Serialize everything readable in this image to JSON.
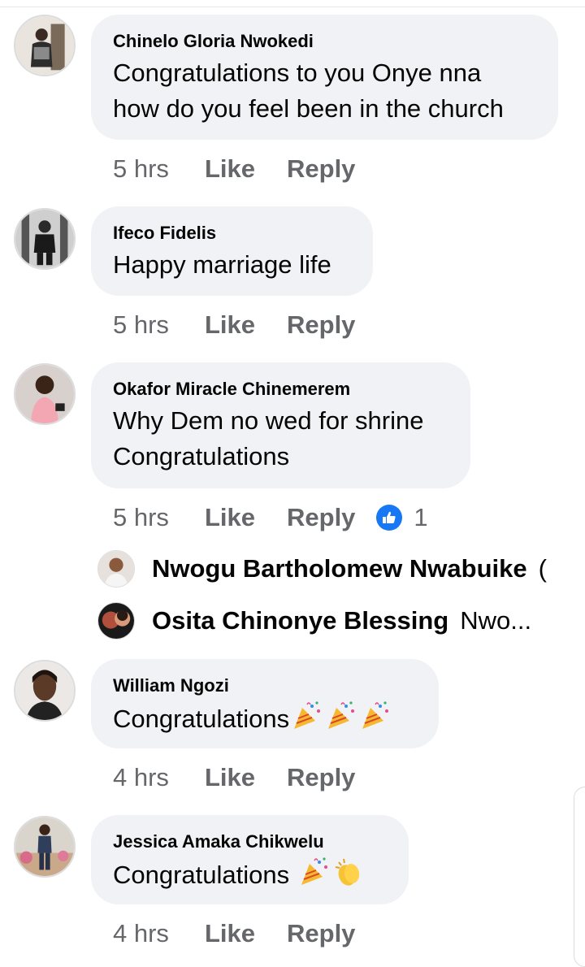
{
  "comments": [
    {
      "author": "Chinelo Gloria Nwokedi",
      "lines": [
        "Congratulations to you Onye nna",
        "how do you feel been in the church"
      ],
      "time": "5 hrs",
      "like": "Like",
      "reply": "Reply"
    },
    {
      "author": "Ifeco Fidelis",
      "lines": [
        "Happy marriage life"
      ],
      "time": "5 hrs",
      "like": "Like",
      "reply": "Reply"
    },
    {
      "author": "Okafor Miracle Chinemerem",
      "lines": [
        "Why Dem no wed for shrine",
        "Congratulations"
      ],
      "time": "5 hrs",
      "like": "Like",
      "reply": "Reply",
      "reaction_count": "1",
      "replies": [
        {
          "name": "Nwogu Bartholomew Nwabuike",
          "text": "("
        },
        {
          "name": "Osita Chinonye Blessing",
          "text": "Nwo..."
        }
      ]
    },
    {
      "author": "William Ngozi",
      "lines": [
        "Congratulations"
      ],
      "time": "4 hrs",
      "like": "Like",
      "reply": "Reply"
    },
    {
      "author": "Jessica Amaka Chikwelu",
      "lines": [
        "Congratulations"
      ],
      "time": "4 hrs",
      "like": "Like",
      "reply": "Reply"
    }
  ],
  "icons": {
    "reaction": "like-thumb-icon",
    "party": "party-popper-icon",
    "clap": "clapping-hands-icon"
  },
  "colors": {
    "bubble": "#f0f2f5",
    "meta": "#65676b",
    "like_reaction": "#1877f2"
  }
}
